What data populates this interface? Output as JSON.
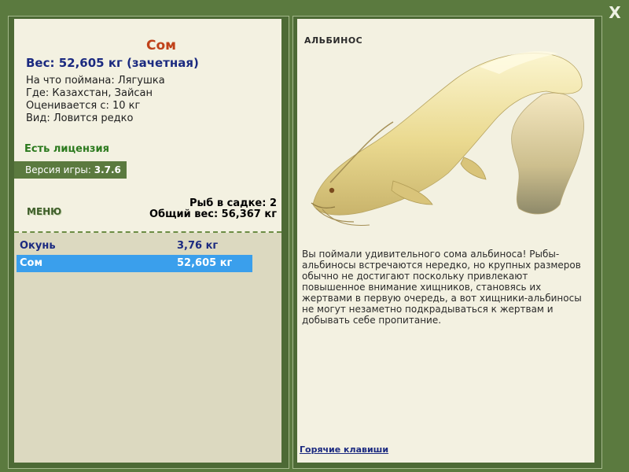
{
  "window": {
    "close_label": "X"
  },
  "fish": {
    "title": "Сом",
    "weight_line": "Вес: 52,605 кг (зачетная)",
    "caught_on": "На что поймана: Лягушка",
    "location": "Где: Казахстан, Зайсан",
    "valued_from": "Оценивается с: 10 кг",
    "kind": "Вид: Ловится редко"
  },
  "license": {
    "label": "Есть лицензия"
  },
  "version": {
    "label": "Версия игры:",
    "value": "3.7.6"
  },
  "menu": {
    "label": "МЕНЮ"
  },
  "cage": {
    "count_line": "Рыб в садке: 2",
    "total_line": "Общий вес: 56,367 кг",
    "items": [
      {
        "name": "Окунь",
        "weight": "3,76 кг",
        "selected": false
      },
      {
        "name": "Сом",
        "weight": "52,605 кг",
        "selected": true
      }
    ]
  },
  "details": {
    "title": "АЛЬБИНОС",
    "description": "Вы поймали удивительного сома альбиноса! Рыбы-альбиносы встречаются нередко, но крупных размеров обычно не достигают поскольку привлекают повышенное внимание хищников, становясь их жертвами в первую очередь, а вот хищники-альбиносы не могут незаметно подкрадываться к жертвам и добывать себе пропитание.",
    "hotkeys_link": "Горячие клавиши"
  },
  "colors": {
    "frame_green": "#5b7a3f",
    "panel_cream": "#f3f1e1",
    "title_orange": "#c0421a",
    "weight_blue": "#1b2a80",
    "license_green": "#2c7a1e",
    "selection_blue": "#3a9fec"
  },
  "icons": {
    "close": "close-icon",
    "fish_image": "albino-catfish-image"
  }
}
